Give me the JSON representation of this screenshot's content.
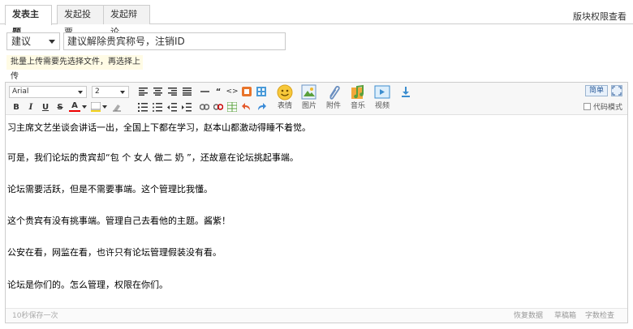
{
  "tabs": [
    {
      "label": "发表主题"
    },
    {
      "label": "发起投票"
    },
    {
      "label": "发起辩论"
    }
  ],
  "permission_link": "版块权限查看",
  "category": {
    "selected": "建议"
  },
  "title_input": {
    "value": "建议解除贵宾称号，注销ID"
  },
  "upload_tip": "批量上传需要先选择文件，再选择上传",
  "toolbar": {
    "font_family": "Arial",
    "font_size": "2",
    "emoji_label": "表情",
    "image_label": "图片",
    "attach_label": "附件",
    "music_label": "音乐",
    "video_label": "视频",
    "simple_label": "简单",
    "code_mode_label": "代码模式"
  },
  "content": {
    "paragraphs": [
      "习主席文艺坐谈会讲话一出，全国上下都在学习，赵本山都激动得睡不着觉。",
      "可是，我们论坛的贵宾却“包 个 女人 做二 奶 ”，还故意在论坛挑起事端。",
      "论坛需要活跃，但是不需要事端。这个管理比我懂。",
      "这个贵宾有没有挑事端。管理自己去看他的主题。酱紫！",
      "公安在看，网监在看，也许只有论坛管理假装没有看。",
      "论坛是你们的。怎么管理，权限在你们。"
    ]
  },
  "statusbar": {
    "autosave": "10秒保存一次",
    "restore": "恢复数据",
    "drafts": "草稿箱",
    "wordcount": "字数检查"
  },
  "colors": {
    "accent": "#2b5c99",
    "tip_bg": "#fffbe5",
    "border": "#cdcdcd"
  }
}
